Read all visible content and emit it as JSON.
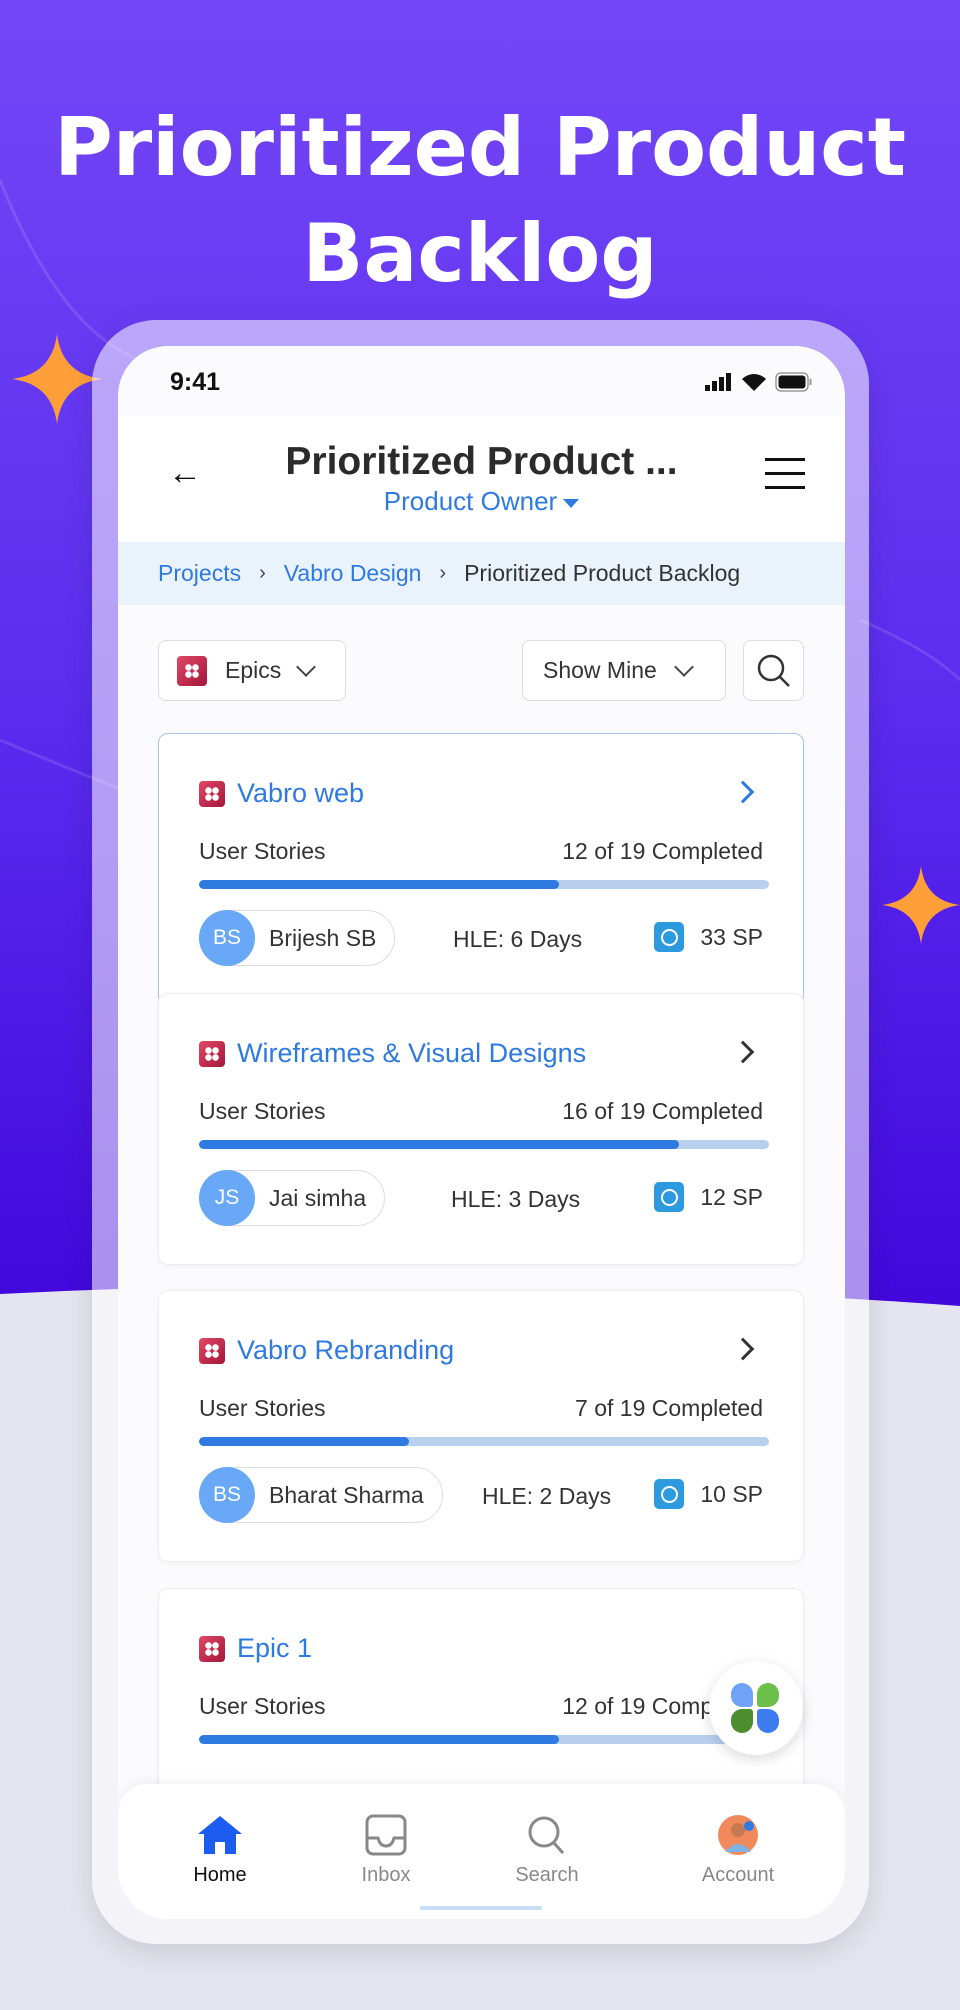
{
  "hero_title": [
    "Prioritized Product",
    "Backlog"
  ],
  "status_bar": {
    "time": "9:41"
  },
  "header": {
    "title": "Prioritized Product ...",
    "subtitle": "Product Owner"
  },
  "breadcrumb": {
    "items": [
      "Projects",
      "Vabro Design"
    ],
    "current": "Prioritized Product Backlog"
  },
  "filters": {
    "type_label": "Epics",
    "show_label": "Show Mine"
  },
  "colors": {
    "accent": "#2f7ae0",
    "brand_purple": "#5a2cef",
    "star": "#ff9f3a"
  },
  "epics": [
    {
      "title": "Vabro web",
      "stories_label": "User Stories",
      "completed": 12,
      "total": 19,
      "completed_text": "12 of 19 Completed",
      "assignee_initials": "BS",
      "assignee": "Brijesh SB",
      "hle_label": "HLE:",
      "hle": "6 Days",
      "sp": "33 SP",
      "selected": true
    },
    {
      "title": "Wireframes & Visual Designs",
      "stories_label": "User Stories",
      "completed": 16,
      "total": 19,
      "completed_text": "16 of 19 Completed",
      "assignee_initials": "JS",
      "assignee": "Jai simha",
      "hle_label": "HLE:",
      "hle": "3 Days",
      "sp": "12 SP",
      "selected": false
    },
    {
      "title": "Vabro Rebranding",
      "stories_label": "User Stories",
      "completed": 7,
      "total": 19,
      "completed_text": "7 of 19 Completed",
      "assignee_initials": "BS",
      "assignee": "Bharat Sharma",
      "hle_label": "HLE:",
      "hle": "2 Days",
      "sp": "10 SP",
      "selected": false
    },
    {
      "title": "Epic 1",
      "stories_label": "User Stories",
      "completed": 12,
      "total": 19,
      "completed_text": "12 of 19 Completed",
      "assignee_initials": "",
      "assignee": "",
      "hle_label": "",
      "hle": "",
      "sp": "",
      "selected": false
    }
  ],
  "bottom_nav": [
    {
      "label": "Home",
      "icon": "home-icon",
      "active": true
    },
    {
      "label": "Inbox",
      "icon": "inbox-icon",
      "active": false
    },
    {
      "label": "Search",
      "icon": "search-icon",
      "active": false
    },
    {
      "label": "Account",
      "icon": "avatar",
      "active": false
    }
  ]
}
